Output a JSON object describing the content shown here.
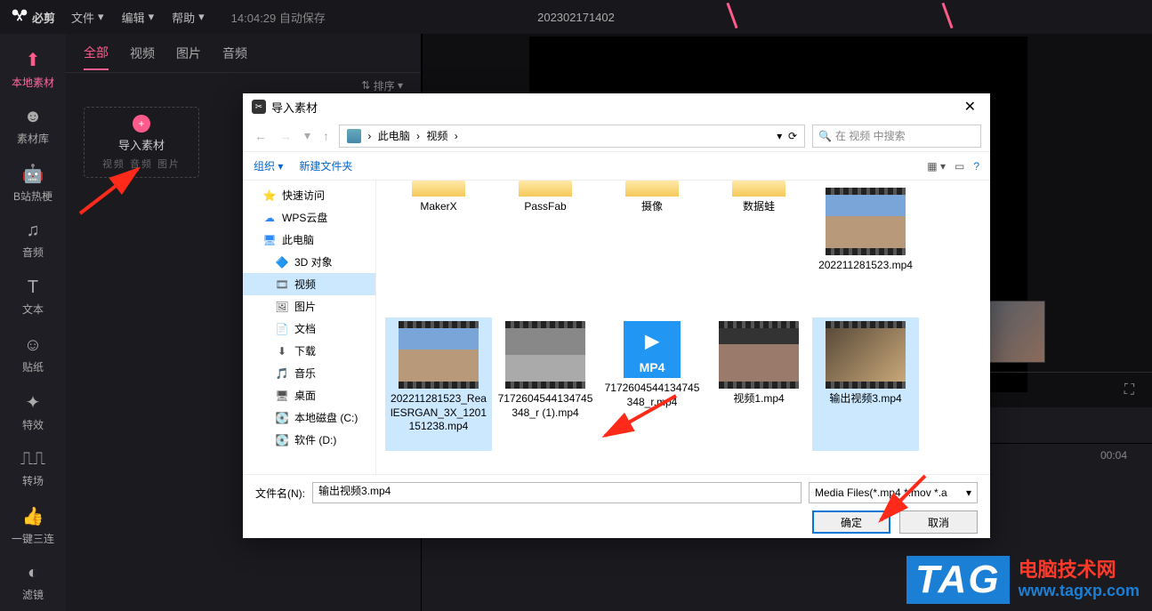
{
  "topbar": {
    "app_name": "必剪",
    "menus": {
      "file": "文件",
      "edit": "编辑",
      "help": "帮助"
    },
    "autosave_time": "14:04:29",
    "autosave_label": "自动保存",
    "project_title": "202302171402"
  },
  "sidebar": {
    "items": [
      {
        "label": "本地素材",
        "icon": "upload"
      },
      {
        "label": "素材库",
        "icon": "face"
      },
      {
        "label": "B站热梗",
        "icon": "robot"
      },
      {
        "label": "音频",
        "icon": "music"
      },
      {
        "label": "文本",
        "icon": "text"
      },
      {
        "label": "贴纸",
        "icon": "sticker"
      },
      {
        "label": "特效",
        "icon": "sparkle"
      },
      {
        "label": "转场",
        "icon": "bars"
      },
      {
        "label": "一键三连",
        "icon": "thumb"
      },
      {
        "label": "滤镜",
        "icon": "filter"
      }
    ]
  },
  "panel": {
    "tabs": {
      "all": "全部",
      "video": "视频",
      "image": "图片",
      "audio": "音频"
    },
    "sort_label": "排序",
    "import": {
      "title": "导入素材",
      "sub": "视频 音频 图片"
    }
  },
  "timeline": {
    "duration": "00:04"
  },
  "dialog": {
    "title": "导入素材",
    "nav": {
      "path_root": "此电脑",
      "path_current": "视频",
      "refresh": "⟳",
      "search_placeholder": "在 视频 中搜索"
    },
    "toolbar": {
      "organize": "组织",
      "new_folder": "新建文件夹"
    },
    "tree": [
      {
        "label": "快速访问",
        "ico": "⭐",
        "color": "#2e8bff"
      },
      {
        "label": "WPS云盘",
        "ico": "☁",
        "color": "#2e8bff"
      },
      {
        "label": "此电脑",
        "ico": "🖥",
        "color": "#2e8bff"
      },
      {
        "label": "3D 对象",
        "ico": "🔷",
        "indent": true
      },
      {
        "label": "视频",
        "ico": "🎞",
        "indent": true,
        "selected": true
      },
      {
        "label": "图片",
        "ico": "🖼",
        "indent": true
      },
      {
        "label": "文档",
        "ico": "📄",
        "indent": true
      },
      {
        "label": "下载",
        "ico": "⬇",
        "indent": true
      },
      {
        "label": "音乐",
        "ico": "🎵",
        "indent": true
      },
      {
        "label": "桌面",
        "ico": "🖥",
        "indent": true
      },
      {
        "label": "本地磁盘 (C:)",
        "ico": "💽",
        "indent": true
      },
      {
        "label": "软件 (D:)",
        "ico": "💽",
        "indent": true
      }
    ],
    "folders": [
      {
        "name": "MakerX"
      },
      {
        "name": "PassFab"
      },
      {
        "name": "摄像"
      },
      {
        "name": "数据蛙"
      }
    ],
    "files": [
      {
        "name": "202211281523.mp4",
        "thumb": "t1"
      },
      {
        "name": "202211281523_RealESRGAN_3X_1201151238.mp4",
        "thumb": "t1",
        "selected": true
      },
      {
        "name": "7172604544134745348_r (1).mp4",
        "thumb": "t2"
      },
      {
        "name": "7172604544134745348_r.mp4",
        "thumb": "mp4"
      },
      {
        "name": "视频1.mp4",
        "thumb": "t4"
      },
      {
        "name": "输出视频3.mp4",
        "thumb": "t3",
        "selected": true
      }
    ],
    "bottom": {
      "filename_label": "文件名(N):",
      "filename_value": "输出视频3.mp4",
      "filetype": "Media Files(*.mp4 *.mov *.a",
      "ok": "确定",
      "cancel": "取消"
    }
  },
  "watermark": {
    "tag": "TAG",
    "line1": "电脑技术网",
    "line2": "www.tagxp.com"
  }
}
